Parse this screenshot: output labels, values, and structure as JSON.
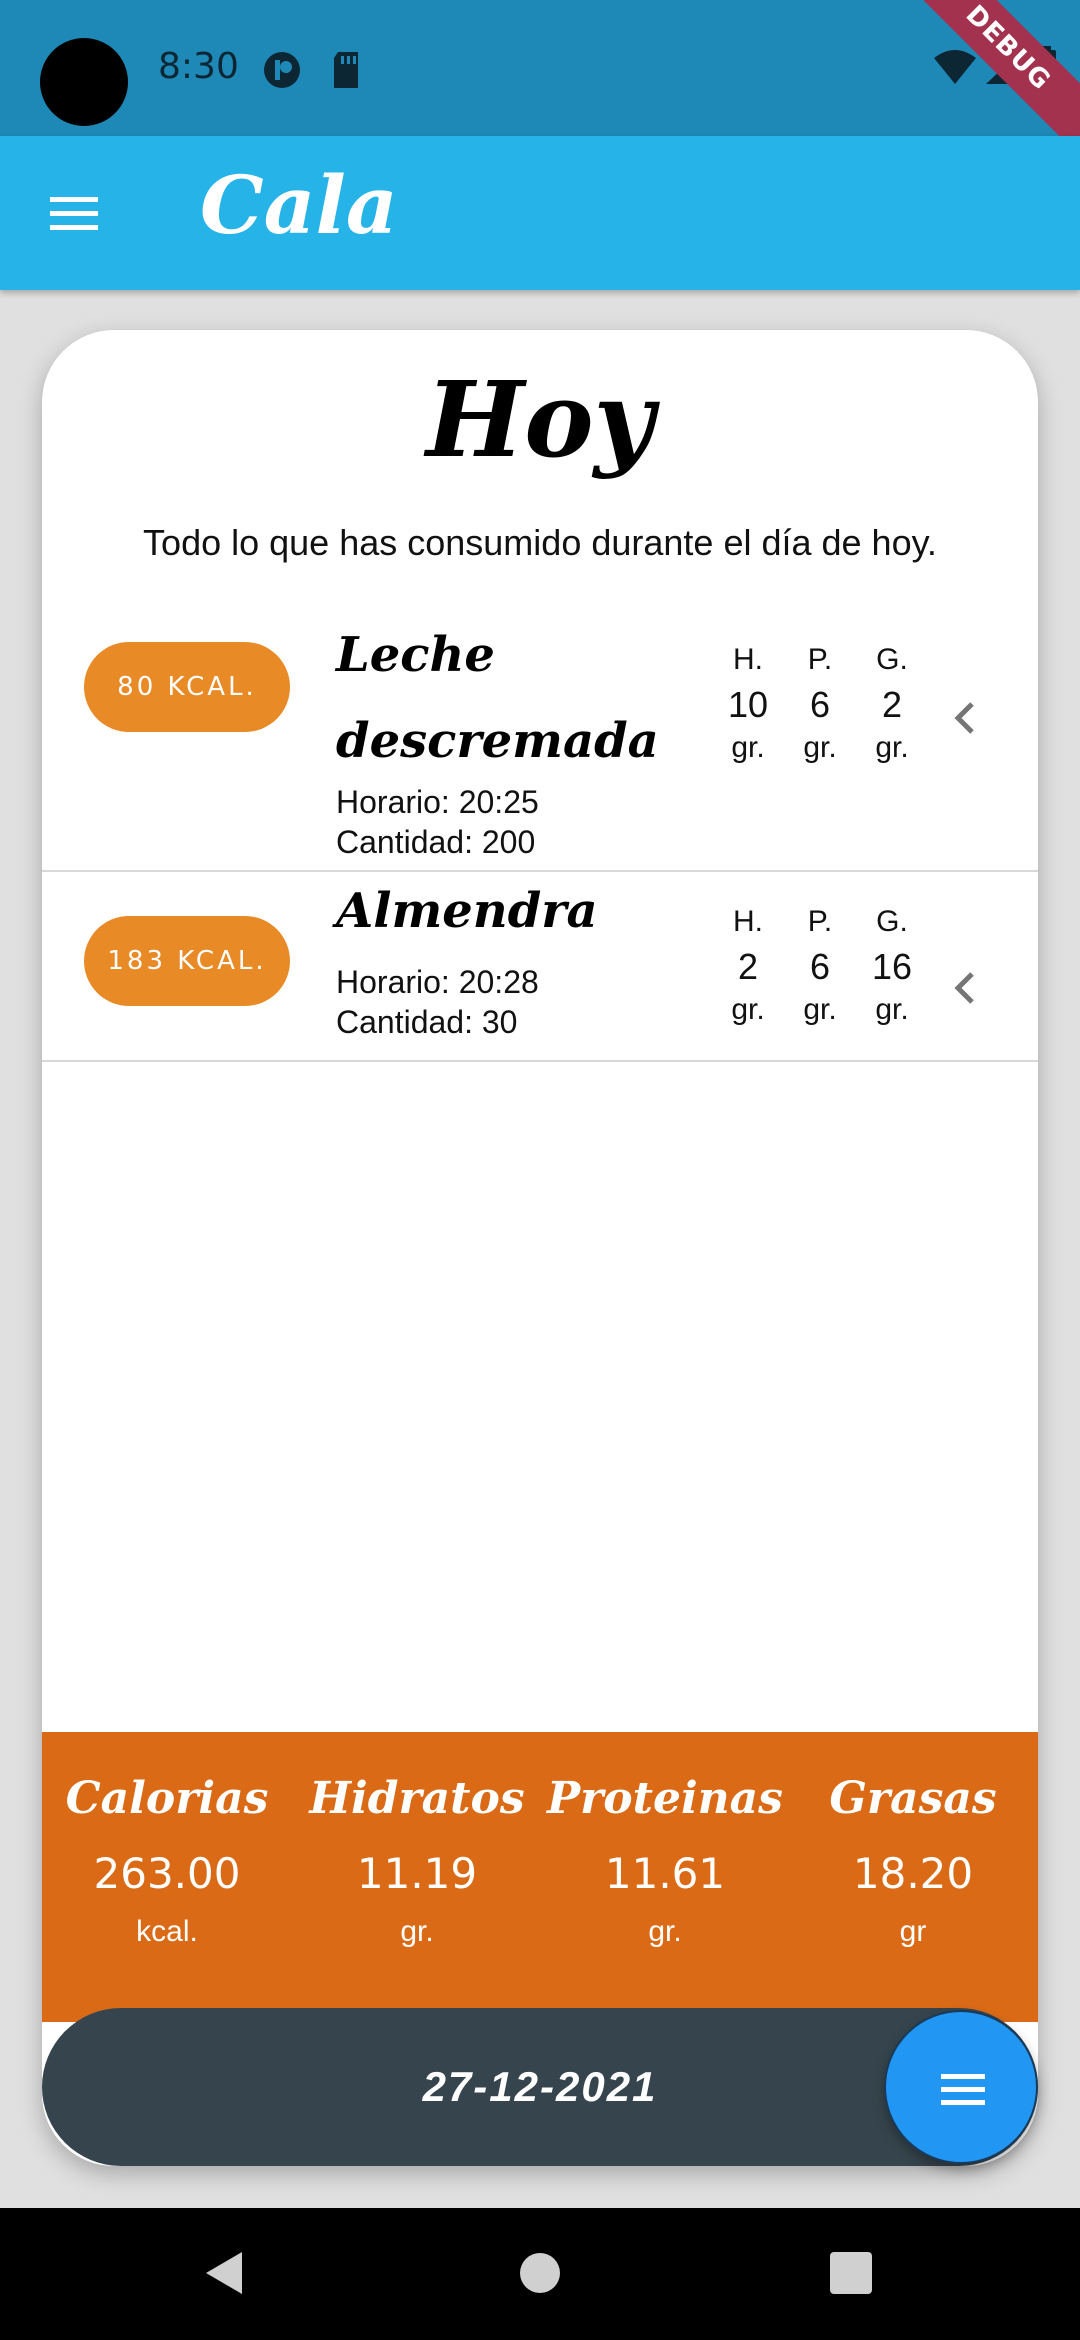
{
  "status_bar": {
    "time": "8:30",
    "debug_label": "DEBUG",
    "icons": [
      "record-icon",
      "sd-card-icon",
      "wifi-icon",
      "signal-icon",
      "battery-icon"
    ]
  },
  "app_bar": {
    "title": "Cala",
    "menu_icon": "menu-icon",
    "color": "#26b4e8"
  },
  "page": {
    "title": "Hoy",
    "subtitle": "Todo lo que has consumido durante el día de hoy."
  },
  "macro_headers": {
    "carbs": "H.",
    "protein": "P.",
    "fat": "G."
  },
  "foods": [
    {
      "kcal": "80 KCAL.",
      "name": "Leche descremada",
      "time": "Horario: 20:25",
      "quantity": "Cantidad: 200",
      "carbs": "10",
      "protein": "6",
      "fat": "2",
      "unit": "gr."
    },
    {
      "kcal": "183 KCAL.",
      "name": "Almendra",
      "time": "Horario: 20:28",
      "quantity": "Cantidad: 30",
      "carbs": "2",
      "protein": "6",
      "fat": "16",
      "unit": "gr."
    }
  ],
  "totals": {
    "calories": {
      "label": "Calorias",
      "value": "263.00",
      "unit": "kcal."
    },
    "carbs": {
      "label": "Hidratos",
      "value": "11.19",
      "unit": "gr."
    },
    "protein": {
      "label": "Proteinas",
      "value": "11.61",
      "unit": "gr."
    },
    "fat": {
      "label": "Grasas",
      "value": "18.20",
      "unit": "gr"
    }
  },
  "date": "27-12-2021",
  "colors": {
    "kcal_pill": "#e88a26",
    "totals_bg": "#da6a16",
    "date_bar": "#36454d",
    "fab": "#2196f3"
  }
}
